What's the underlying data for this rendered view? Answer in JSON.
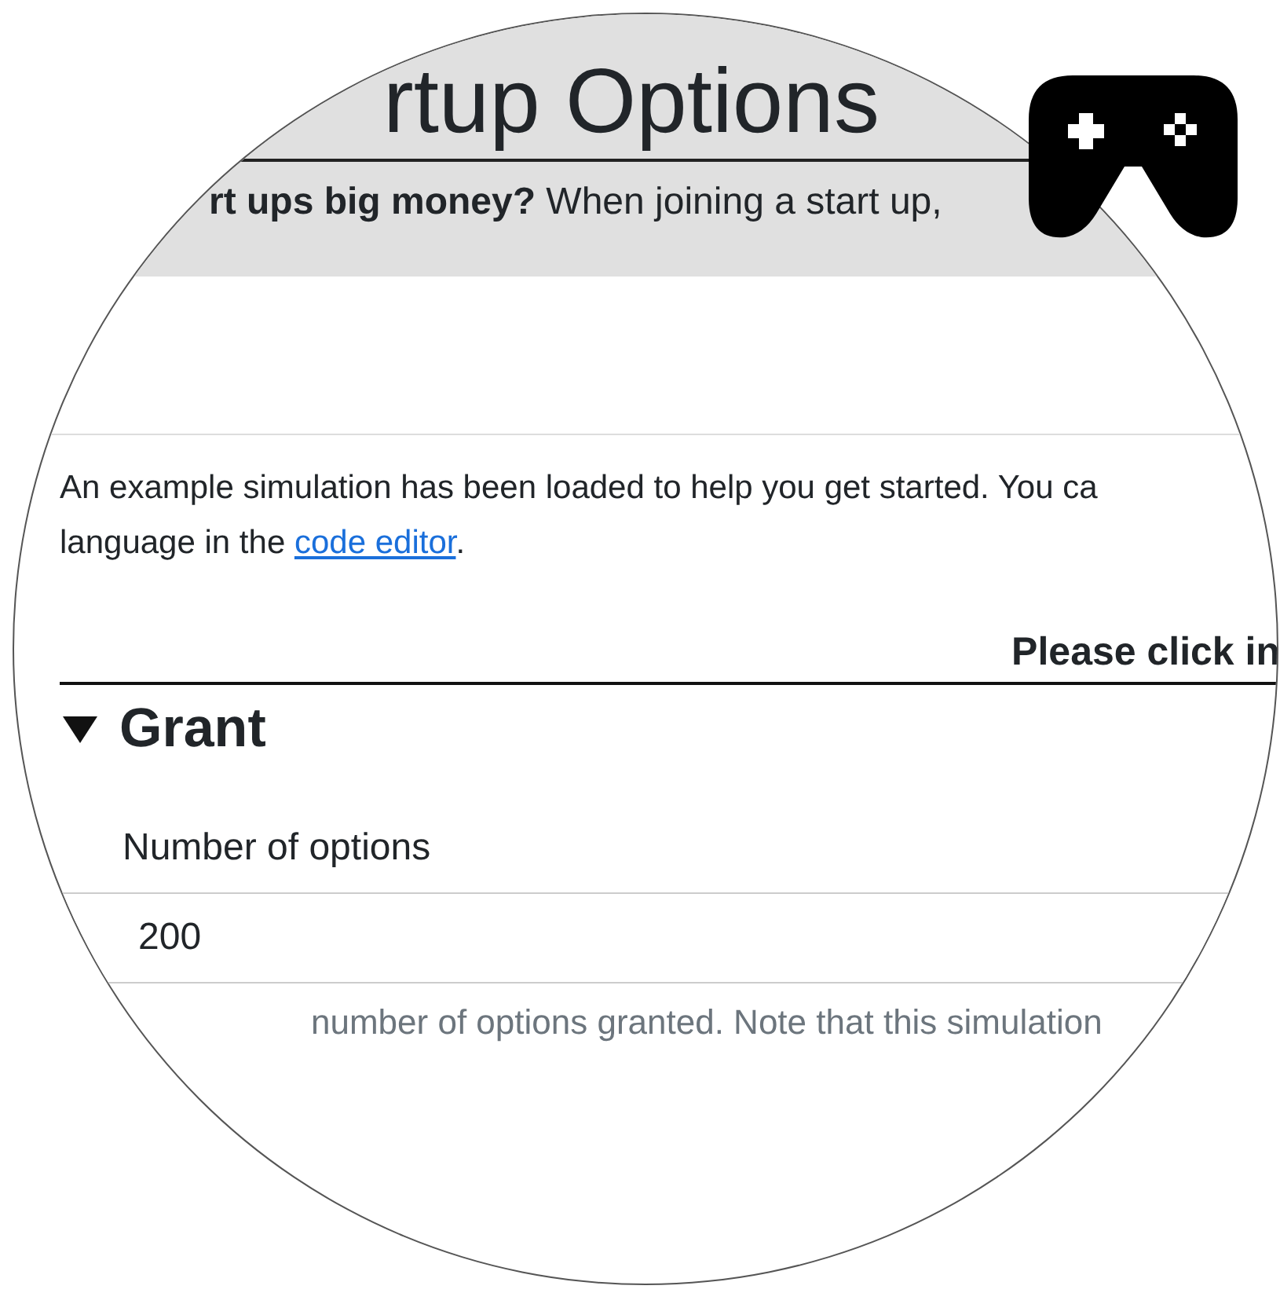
{
  "header": {
    "title": "rtup Options",
    "subtitle": "**rt ups big money?** When joining a start up,"
  },
  "intro": {
    "text": "An example simulation has been loaded to help you get started. You ca",
    "text2": "language in the ",
    "link": "code editor",
    "after": "."
  },
  "prompt": "Please click in",
  "section": {
    "title": "Grant",
    "expanded": true
  },
  "field": {
    "label": "Number of options",
    "value": "200",
    "help": "number of options granted. Note that this simulation"
  }
}
